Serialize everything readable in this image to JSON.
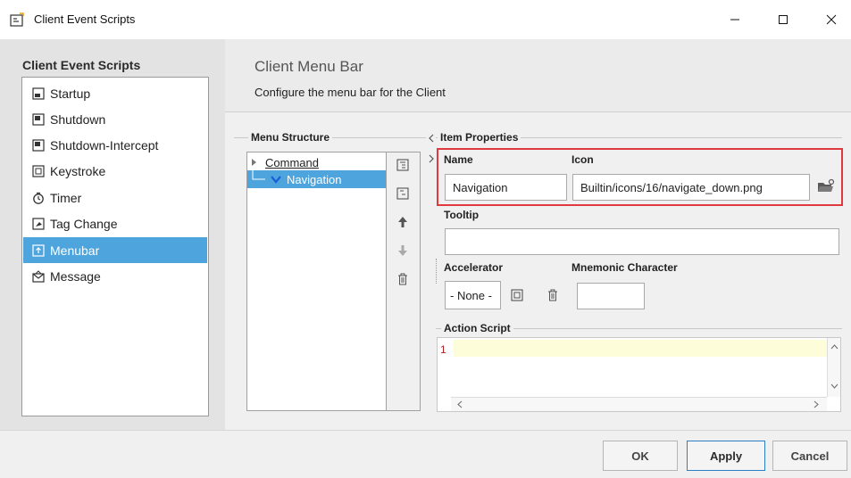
{
  "window": {
    "title": "Client Event Scripts"
  },
  "sidebar": {
    "title": "Client Event Scripts",
    "items": [
      {
        "label": "Startup",
        "icon": "script-icon"
      },
      {
        "label": "Shutdown",
        "icon": "script-icon"
      },
      {
        "label": "Shutdown-Intercept",
        "icon": "script-icon"
      },
      {
        "label": "Keystroke",
        "icon": "keyboard-icon"
      },
      {
        "label": "Timer",
        "icon": "clock-icon"
      },
      {
        "label": "Tag Change",
        "icon": "tag-icon"
      },
      {
        "label": "Menubar",
        "icon": "menubar-icon",
        "selected": true
      },
      {
        "label": "Message",
        "icon": "envelope-icon"
      }
    ]
  },
  "header": {
    "title": "Client Menu Bar",
    "description": "Configure the menu bar for the Client"
  },
  "menu_structure": {
    "label": "Menu Structure",
    "items": [
      {
        "label": "Command"
      },
      {
        "label": "Navigation",
        "selected": true
      }
    ]
  },
  "item_properties": {
    "label": "Item Properties",
    "name_label": "Name",
    "name_value": "Navigation",
    "icon_label": "Icon",
    "icon_value": "Builtin/icons/16/navigate_down.png",
    "tooltip_label": "Tooltip",
    "tooltip_value": "",
    "accelerator_label": "Accelerator",
    "accelerator_value": "- None -",
    "mnemonic_label": "Mnemonic Character",
    "mnemonic_value": "",
    "action_script_label": "Action Script",
    "line_number": "1"
  },
  "footer": {
    "ok": "OK",
    "apply": "Apply",
    "cancel": "Cancel"
  },
  "colors": {
    "selection": "#4ea5dd",
    "highlight_border": "#e0393f",
    "apply_border": "#2b7fc6"
  }
}
